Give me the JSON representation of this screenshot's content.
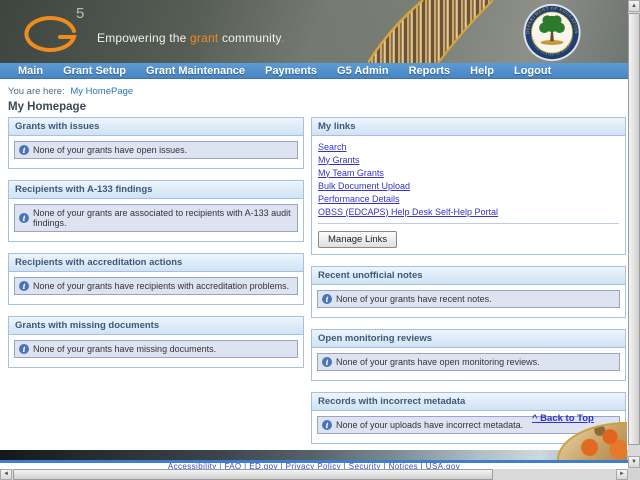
{
  "header": {
    "logo_sup": "5",
    "tagline_pre": "Empowering the ",
    "tagline_grant": "grant",
    "tagline_post": " community",
    "tagline_period": ".",
    "seal_top": "DEPARTMENT OF EDUCATION",
    "seal_bottom": "UNITED STATES OF AMERICA"
  },
  "nav": {
    "items": [
      "Main",
      "Grant Setup",
      "Grant Maintenance",
      "Payments",
      "G5 Admin",
      "Reports",
      "Help",
      "Logout"
    ]
  },
  "breadcrumb": {
    "prefix": "You are here:",
    "current": "My HomePage"
  },
  "page_title": "My Homepage",
  "left_panels": [
    {
      "title": "Grants with issues",
      "message": "None of your grants have open issues."
    },
    {
      "title": "Recipients with A-133 findings",
      "message": "None of your grants are associated to recipients with A-133 audit findings."
    },
    {
      "title": "Recipients with accreditation actions",
      "message": "None of your grants have recipients with accreditation problems."
    },
    {
      "title": "Grants with missing documents",
      "message": "None of your grants have missing documents."
    }
  ],
  "my_links": {
    "title": "My links",
    "links": [
      "Search",
      "My Grants",
      "My Team Grants",
      "Bulk Document Upload",
      "Performance Details",
      "OBSS (EDCAPS) Help Desk Self-Help Portal"
    ],
    "manage_button": "Manage Links"
  },
  "right_panels": [
    {
      "title": "Recent unofficial notes",
      "message": "None of your grants have recent notes."
    },
    {
      "title": "Open monitoring reviews",
      "message": "None of your grants have open monitoring reviews."
    },
    {
      "title": "Records with incorrect metadata",
      "message": "None of your uploads have incorrect metadata."
    }
  ],
  "back_to_top": "^ Back to Top",
  "footer": {
    "links_text": "Accessibility | FAQ | ED.gov | Privacy Policy | Security | Notices | USA.gov"
  },
  "icons": {
    "info": "i",
    "up_arrow": "▲",
    "down_arrow": "▼",
    "left_arrow": "◄",
    "right_arrow": "►"
  },
  "colors": {
    "nav_blue": "#4d8ecb",
    "link_blue": "#3333cc",
    "brand_orange": "#f08c1e",
    "panel_border": "#a3c1e0",
    "info_bg": "#dde3f1"
  }
}
